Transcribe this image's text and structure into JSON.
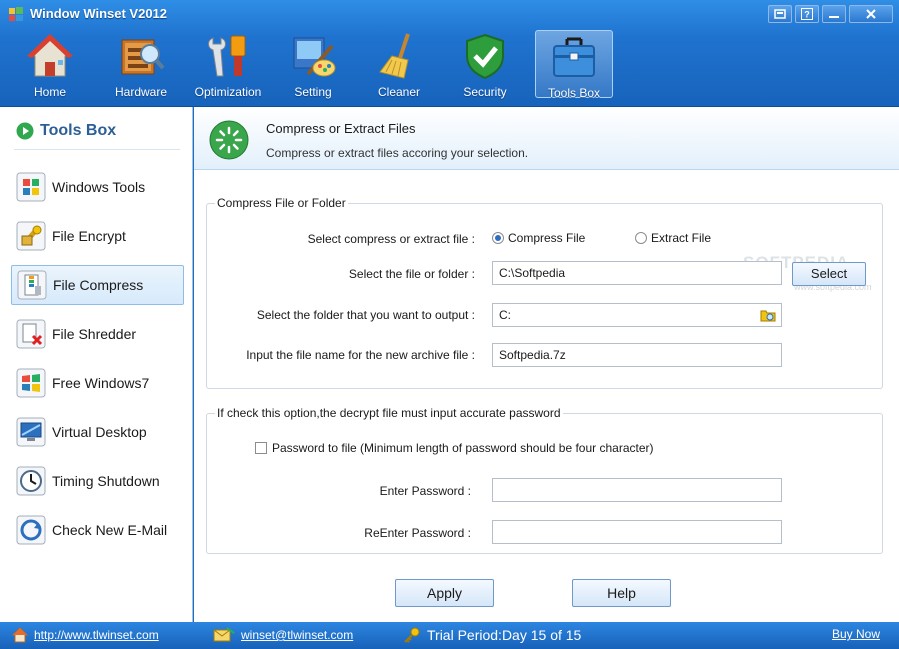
{
  "window": {
    "title": "Window Winset V2012"
  },
  "nav": [
    {
      "label": "Home",
      "icon": "home-icon"
    },
    {
      "label": "Hardware",
      "icon": "hardware-icon"
    },
    {
      "label": "Optimization",
      "icon": "optimization-icon"
    },
    {
      "label": "Setting",
      "icon": "setting-icon"
    },
    {
      "label": "Cleaner",
      "icon": "broom-icon"
    },
    {
      "label": "Security",
      "icon": "shield-icon"
    },
    {
      "label": "Tools Box",
      "icon": "toolbox-icon",
      "active": true
    }
  ],
  "sidebar": {
    "title": "Tools Box",
    "items": [
      {
        "label": "Windows Tools",
        "icon": "windows-icon"
      },
      {
        "label": "File Encrypt",
        "icon": "lock-icon"
      },
      {
        "label": "File Compress",
        "icon": "archive-icon",
        "active": true
      },
      {
        "label": "File Shredder",
        "icon": "shredder-icon"
      },
      {
        "label": "Free Windows7",
        "icon": "windows7-icon"
      },
      {
        "label": "Virtual Desktop",
        "icon": "desktop-icon"
      },
      {
        "label": "Timing Shutdown",
        "icon": "clock-icon"
      },
      {
        "label": "Check New E-Mail",
        "icon": "email-icon"
      }
    ]
  },
  "panel": {
    "title": "Compress or Extract Files",
    "subtitle": "Compress or extract files accoring your selection."
  },
  "compress_group": {
    "legend": "Compress File or Folder",
    "mode_label": "Select compress or extract file :",
    "mode_options": [
      "Compress  File",
      "Extract File"
    ],
    "selected_mode": "Compress  File",
    "file_label": "Select the file or folder :",
    "file_value": "C:\\Softpedia",
    "select_button": "Select",
    "output_label": "Select the folder that you want to output :",
    "output_value": "C:",
    "archive_label": "Input the file name for the new archive file :",
    "archive_value": "Softpedia.7z"
  },
  "password_group": {
    "legend": "If check this option,the decrypt file must input accurate password",
    "checkbox_label": "Password to file (Minimum length of password should be four character)",
    "checked": false,
    "enter_label": "Enter Password :",
    "reenter_label": "ReEnter Password :",
    "enter_value": "",
    "reenter_value": ""
  },
  "buttons": {
    "apply": "Apply",
    "help": "Help"
  },
  "watermark": {
    "brand": "SOFTPEDIA",
    "url": "www.softpedia.com"
  },
  "status": {
    "website": "http://www.tlwinset.com",
    "email": "winset@tlwinset.com",
    "trial": "Trial Period:Day 15 of 15",
    "buy": "Buy Now"
  },
  "colors": {
    "header": "#1f73cf",
    "accent": "#2c6fbf",
    "sidebar_active": "#d7eafb",
    "status_bar": "#1761b9"
  }
}
